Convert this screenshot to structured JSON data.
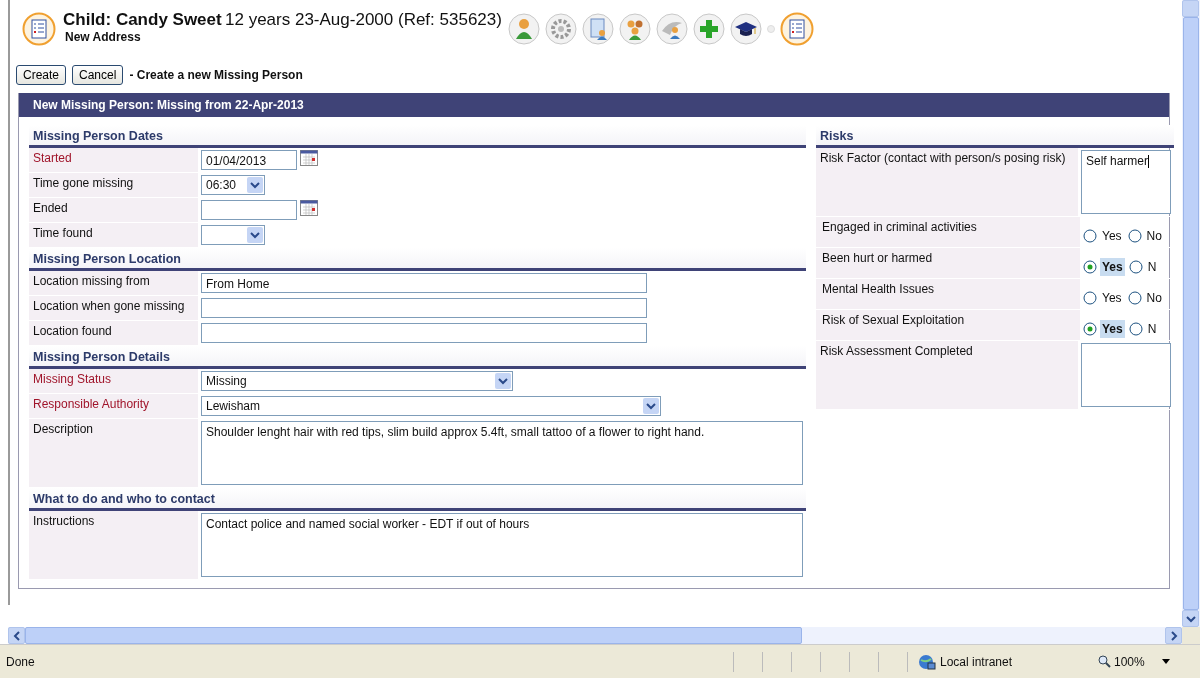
{
  "header": {
    "title": "Child: Candy Sweet",
    "details": "12 years 23-Aug-2000 (Ref: 535623)",
    "subtitle": "New Address"
  },
  "actions": {
    "buttons": [
      "Create",
      "Cancel"
    ],
    "caption": "- Create a new Missing Person"
  },
  "form": {
    "title": "New Missing Person: Missing from 22-Apr-2013",
    "sections": [
      {
        "title": "Missing Person Dates",
        "fields": [
          {
            "label": "Started",
            "required": true,
            "kind": "date",
            "value": "01/04/2013"
          },
          {
            "label": "Time gone missing",
            "required": false,
            "kind": "time",
            "value": "06:30"
          },
          {
            "label": "Ended",
            "required": false,
            "kind": "date"
          },
          {
            "label": "Time found",
            "required": false,
            "kind": "time"
          }
        ]
      },
      {
        "title": "Missing Person Location",
        "fields": [
          {
            "label": "Location missing from",
            "required": false,
            "kind": "text",
            "value": "From Home"
          },
          {
            "label": "Location when gone missing",
            "required": false,
            "kind": "text"
          },
          {
            "label": "Location found",
            "required": false,
            "kind": "text"
          }
        ]
      },
      {
        "title": "Missing Person Details",
        "fields": [
          {
            "label": "Missing Status",
            "required": true,
            "kind": "select",
            "value": "Missing"
          },
          {
            "label": "Responsible Authority",
            "required": true,
            "kind": "wide_select",
            "value": "Lewisham"
          },
          {
            "label": "Description",
            "required": false,
            "kind": "textarea",
            "value": "Shoulder lenght hair with red tips, slim build approx 5.4ft, small tattoo of a flower to right hand."
          }
        ]
      },
      {
        "title": "What to do and who to contact",
        "fields": [
          {
            "label": "Instructions",
            "required": false,
            "kind": "textarea",
            "value": "Contact police and named social worker - EDT if out of hours"
          }
        ]
      }
    ]
  },
  "risks": {
    "title": "Risks",
    "fields": [
      {
        "label": "Risk Factor (contact with person/s posing risk)",
        "kind": "textarea",
        "value": "Self harmer"
      },
      {
        "label": "Engaged in criminal activities",
        "kind": "radio",
        "options": [
          {
            "label": "Yes",
            "selected": false
          },
          {
            "label": "No",
            "selected": false
          }
        ]
      },
      {
        "label": "Been hurt or harmed",
        "kind": "radio",
        "options": [
          {
            "label": "Yes",
            "selected": true
          },
          {
            "label": "N",
            "selected": false
          }
        ]
      },
      {
        "label": "Mental Health Issues",
        "kind": "radio",
        "options": [
          {
            "label": "Yes",
            "selected": false
          },
          {
            "label": "No",
            "selected": false
          }
        ]
      },
      {
        "label": "Risk of Sexual Exploitation",
        "kind": "radio",
        "options": [
          {
            "label": "Yes",
            "selected": true
          },
          {
            "label": "N",
            "selected": false
          }
        ]
      },
      {
        "label": "Risk Assessment Completed",
        "kind": "textarea"
      }
    ]
  },
  "status_bar": {
    "text": "Done",
    "zone": "Local intranet",
    "zoom": "100%"
  }
}
